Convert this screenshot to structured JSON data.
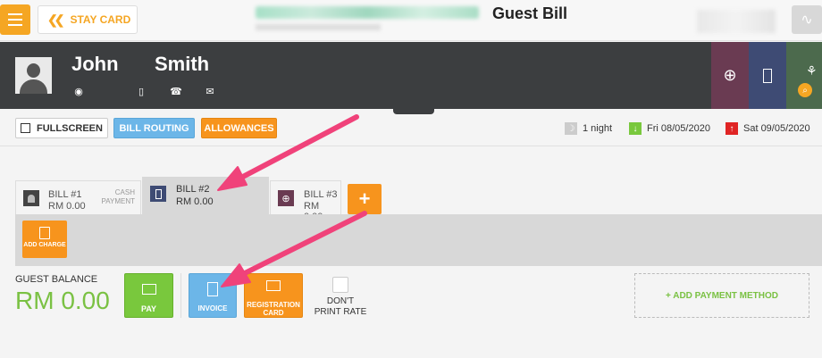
{
  "header": {
    "stay_card_label": "STAY CARD",
    "title": "Guest Bill"
  },
  "guest": {
    "first_name": "John",
    "last_name": "Smith"
  },
  "toolbar": {
    "fullscreen_label": "FULLSCREEN",
    "bill_routing_label": "BILL ROUTING",
    "allowances_label": "ALLOWANCES",
    "nights": "1 night",
    "arrival": "Fri 08/05/2020",
    "departure": "Sat 09/05/2020"
  },
  "bills": [
    {
      "name": "BILL #1",
      "amount": "RM 0.00",
      "payment": "CASH PAYMENT"
    },
    {
      "name": "BILL #2",
      "amount": "RM 0.00"
    },
    {
      "name": "BILL #3",
      "amount": "RM 0.00"
    }
  ],
  "add_bill_label": "+",
  "add_charge_label": "ADD CHARGE",
  "balance": {
    "label": "GUEST BALANCE",
    "value": "RM 0.00"
  },
  "actions": {
    "pay_label": "PAY",
    "invoice_label": "INVOICE",
    "registration_card_label": "REGISTRATION CARD",
    "dont_print_rate_label": "DON'T PRINT RATE",
    "add_payment_method_label": "+ ADD PAYMENT METHOD"
  },
  "colors": {
    "orange": "#f7941d",
    "blue": "#6cb6e8",
    "green": "#79c83d",
    "arrow": "#f0427a",
    "header_dark": "#3c3e40"
  }
}
